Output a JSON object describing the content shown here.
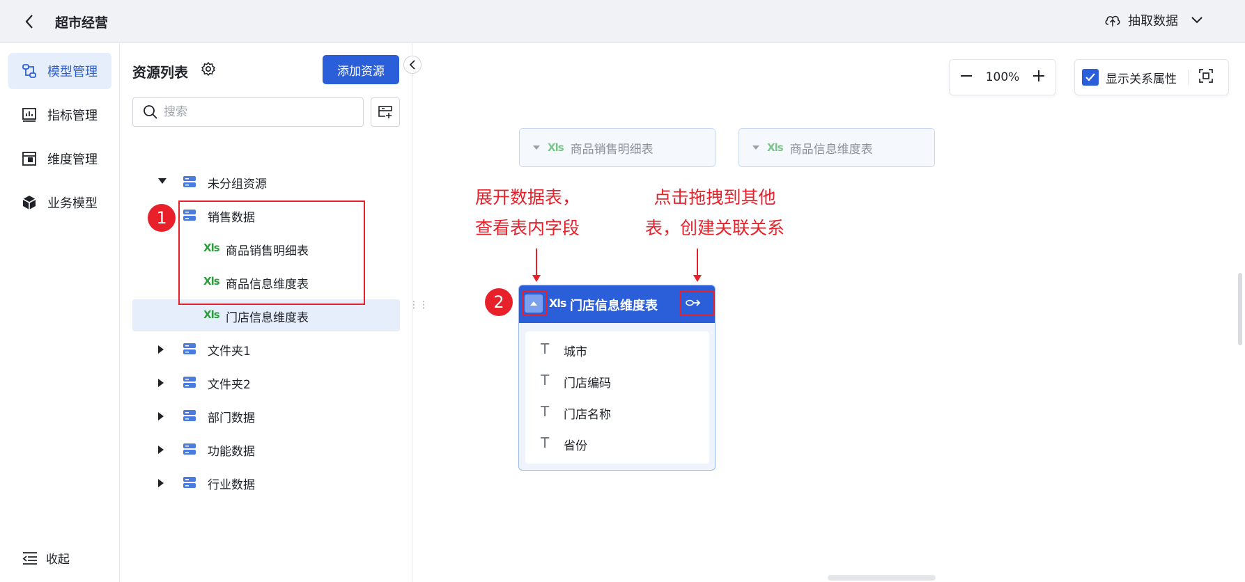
{
  "topbar": {
    "title": "超市经营",
    "extract_label": "抽取数据"
  },
  "nav": {
    "items": [
      {
        "label": "模型管理",
        "icon": "model-icon",
        "active": true
      },
      {
        "label": "指标管理",
        "icon": "metric-icon",
        "active": false
      },
      {
        "label": "维度管理",
        "icon": "dimension-icon",
        "active": false
      },
      {
        "label": "业务模型",
        "icon": "cube-icon",
        "active": false
      }
    ],
    "collapse_label": "收起"
  },
  "resources": {
    "title": "资源列表",
    "add_label": "添加资源",
    "search_placeholder": "搜索",
    "tree": [
      {
        "label": "未分组资源",
        "type": "group",
        "expanded": true
      },
      {
        "label": "销售数据",
        "type": "group",
        "expanded": true
      },
      {
        "label": "商品销售明细表",
        "type": "table",
        "file": "Xls"
      },
      {
        "label": "商品信息维度表",
        "type": "table",
        "file": "Xls"
      },
      {
        "label": "门店信息维度表",
        "type": "table",
        "file": "Xls",
        "selected": true
      },
      {
        "label": "文件夹1",
        "type": "group",
        "expanded": false
      },
      {
        "label": "文件夹2",
        "type": "group",
        "expanded": false
      },
      {
        "label": "部门数据",
        "type": "group",
        "expanded": false
      },
      {
        "label": "功能数据",
        "type": "group",
        "expanded": false
      },
      {
        "label": "行业数据",
        "type": "group",
        "expanded": false
      }
    ]
  },
  "canvas": {
    "zoom": "100%",
    "show_relation_label": "显示关系属性",
    "show_relation_checked": true,
    "ghost_tables": [
      {
        "label": "商品销售明细表",
        "file": "Xls"
      },
      {
        "label": "商品信息维度表",
        "file": "Xls"
      }
    ],
    "active_table": {
      "file": "Xls",
      "name": "门店信息维度表",
      "fields": [
        {
          "type": "T",
          "name": "城市"
        },
        {
          "type": "T",
          "name": "门店编码"
        },
        {
          "type": "T",
          "name": "门店名称"
        },
        {
          "type": "T",
          "name": "省份"
        }
      ]
    }
  },
  "annotations": {
    "badge1": "1",
    "badge2": "2",
    "note_expand_line1": "展开数据表，",
    "note_expand_line2": "查看表内字段",
    "note_drag_line1": "点击拖拽到其他",
    "note_drag_line2": "表，创建关联关系"
  },
  "colors": {
    "accent": "#2b5fd9",
    "annotation_red": "#e8202a",
    "xls_green": "#2e9c3e"
  }
}
